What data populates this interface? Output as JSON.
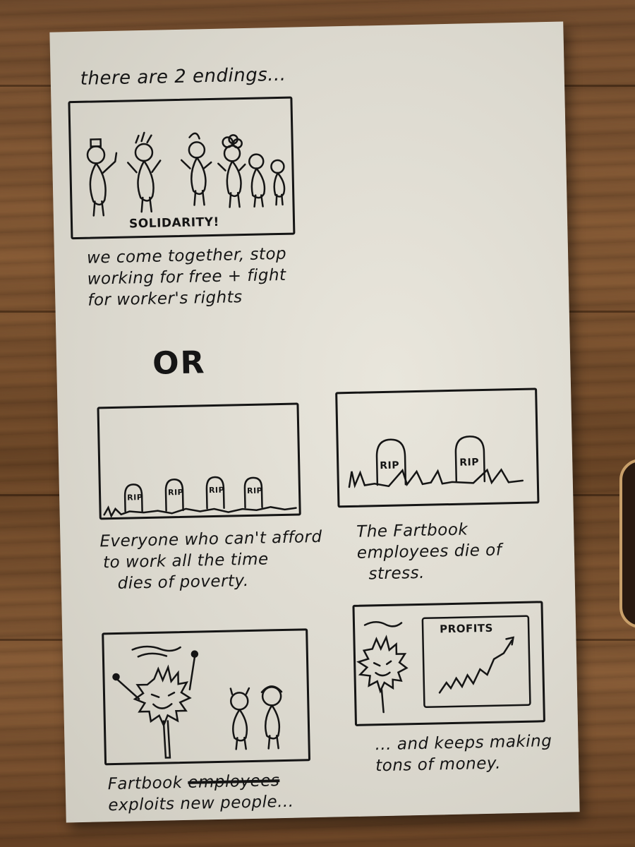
{
  "title": "there are 2 endings...",
  "panel1": {
    "caption_in_panel": "SOLIDARITY!",
    "caption_lines": [
      "we come together, stop",
      "working for free + fight",
      "for worker's rights"
    ]
  },
  "or_label": "OR",
  "panel2": {
    "tombstone_label": "RIP",
    "caption_lines": [
      "Everyone who can't afford",
      "to work all the time",
      "dies of poverty."
    ]
  },
  "panel3": {
    "tombstone_label": "RIP",
    "caption_lines": [
      "The Fartbook",
      "employees die of",
      "stress."
    ]
  },
  "panel4": {
    "caption_word": "Fartbook",
    "caption_scribble": "employees",
    "caption_line2": "exploits new people..."
  },
  "panel5": {
    "chart_label": "PROFITS",
    "caption_lines": [
      "... and keeps making",
      "tons of money."
    ]
  },
  "colors": {
    "ink": "#151515",
    "paper": "#e6e3d9",
    "wood": "#7a5232"
  }
}
